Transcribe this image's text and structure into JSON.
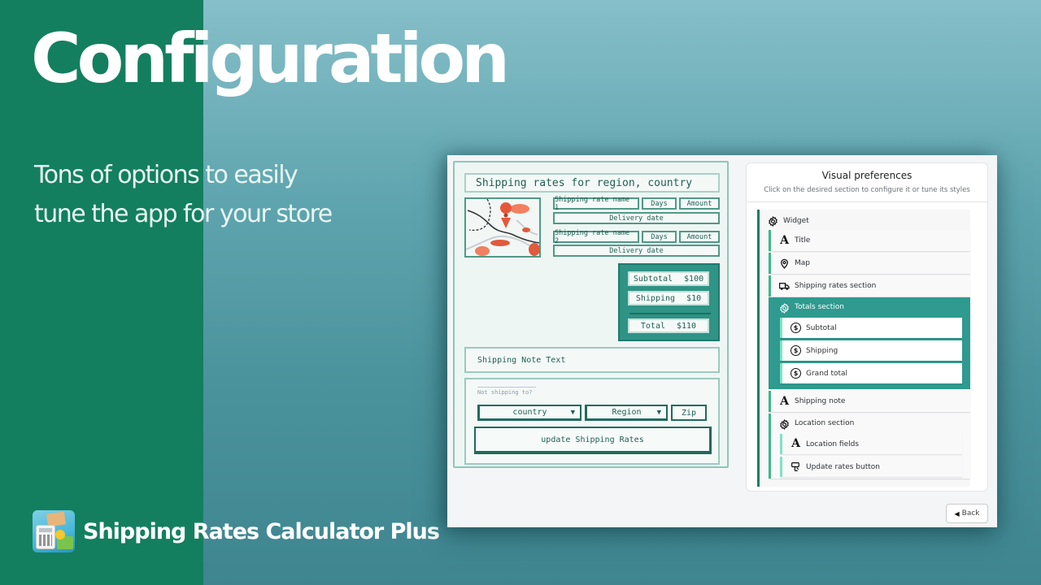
{
  "hero": {
    "title": "Configuration",
    "subtitle_line1": "Tons of options to easily",
    "subtitle_line2": "tune the app for your store"
  },
  "brand": {
    "name": "Shipping Rates Calculator Plus",
    "logo_icon": "calculator-shipping-logo"
  },
  "colors": {
    "left_band": "#137f5e",
    "accent": "#1a7f60",
    "active_section": "#2f9a8f",
    "sketch_ink": "#1f5f52"
  },
  "mockup": {
    "title": "Shipping rates for region, country",
    "rates": [
      {
        "name": "Shipping rate name 1",
        "days": "Days",
        "amount": "Amount",
        "delivery": "Delivery date"
      },
      {
        "name": "Shipping rate name 2",
        "days": "Days",
        "amount": "Amount",
        "delivery": "Delivery date"
      }
    ],
    "totals": {
      "subtotal_label": "Subtotal",
      "subtotal_value": "$100",
      "shipping_label": "Shipping",
      "shipping_value": "$10",
      "total_label": "Total",
      "total_value": "$110"
    },
    "shipping_note": "Shipping Note Text",
    "location": {
      "label": "Not shipping to?",
      "country": "country",
      "region": "Region",
      "zip": "Zip",
      "update_button": "update Shipping Rates"
    }
  },
  "panel": {
    "title": "Visual preferences",
    "subtitle": "Click on the desired section to configure it or tune its styles",
    "root": {
      "label": "Widget",
      "icon": "gear-icon"
    },
    "items": [
      {
        "label": "Title",
        "icon": "text-icon"
      },
      {
        "label": "Map",
        "icon": "map-pin-icon"
      },
      {
        "label": "Shipping rates section",
        "icon": "truck-icon"
      },
      {
        "label": "Totals section",
        "icon": "gear-icon",
        "active": true,
        "children": [
          {
            "label": "Subtotal",
            "icon": "dollar-icon"
          },
          {
            "label": "Shipping",
            "icon": "dollar-icon"
          },
          {
            "label": "Grand total",
            "icon": "dollar-icon"
          }
        ]
      },
      {
        "label": "Shipping note",
        "icon": "text-icon"
      },
      {
        "label": "Location section",
        "icon": "gear-icon",
        "children": [
          {
            "label": "Location fields",
            "icon": "text-icon"
          },
          {
            "label": "Update rates button",
            "icon": "button-icon"
          }
        ]
      }
    ],
    "back_label": "Back",
    "back_icon": "◀"
  }
}
